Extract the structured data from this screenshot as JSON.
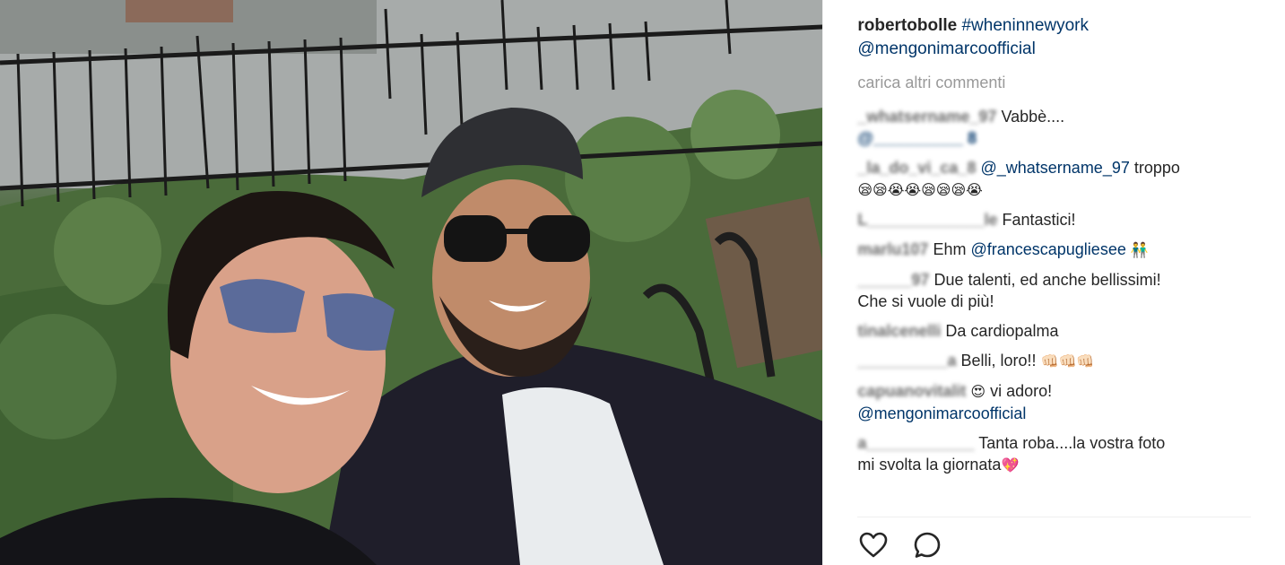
{
  "post": {
    "caption": {
      "username": "robertobolle",
      "hashtag": "#wheninnewyork",
      "mention": "@mengonimarcoofficial"
    },
    "load_more": "carica altri commenti",
    "comments": [
      {
        "user": "_whatsername_97",
        "lines": [
          "Vabbè....",
          "@__________ 8"
        ]
      },
      {
        "user": "_la_do_vi_ca_8",
        "mention": "@_whatsername_97",
        "text": "troppo",
        "emoji": "😪😪😭😭😪😪😪😭"
      },
      {
        "user": "L_____________le",
        "text": "Fantastici!"
      },
      {
        "user": "marlu107",
        "text": "Ehm",
        "mention": "@francescapugliesee",
        "emoji": "👬"
      },
      {
        "user": "______97",
        "text": "Due talenti, ed anche bellissimi!",
        "text2": "Che si vuole di più!"
      },
      {
        "user": "tinalcenelli",
        "text": "Da cardiopalma"
      },
      {
        "user": "__________a",
        "text": "Belli, loro!!",
        "emoji": "👊🏻👊🏻👊🏻"
      },
      {
        "user": "capuanovitalit",
        "emoji": "😍",
        "text": "vi adoro!",
        "mention": "@mengonimarcoofficial"
      },
      {
        "user": "a____________",
        "text": "Tanta roba....la vostra foto",
        "text2": "mi svolta la giornata",
        "emoji": "💖"
      }
    ],
    "actions": {
      "like_icon": "heart-icon",
      "comment_icon": "comment-bubble-icon"
    }
  }
}
